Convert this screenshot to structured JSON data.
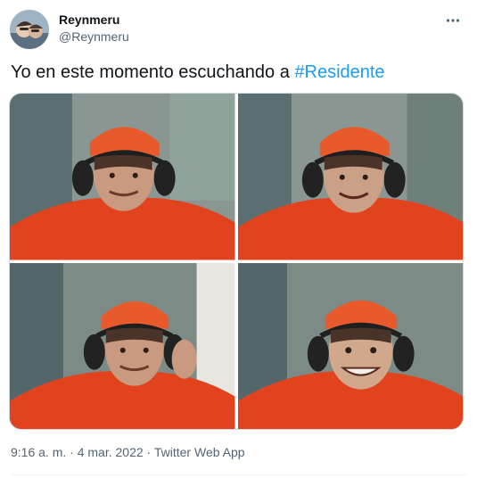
{
  "user": {
    "display_name": "Reynmeru",
    "handle": "@Reynmeru"
  },
  "tweet": {
    "text_before": "Yo en este momento escuchando a ",
    "hashtag": "#Residente",
    "media_description_icon": "photo-collage-icon"
  },
  "meta": {
    "time": "9:16 a. m.",
    "separator": " · ",
    "date": "4 mar. 2022",
    "source": "Twitter Web App"
  },
  "colors": {
    "hashtag": "#1d9bf0",
    "secondary_text": "#536471",
    "primary_text": "#0f1419",
    "shirt": "#e2431f",
    "cap": "#e85a2c"
  },
  "icons": {
    "more": "more-horizontal-icon"
  }
}
